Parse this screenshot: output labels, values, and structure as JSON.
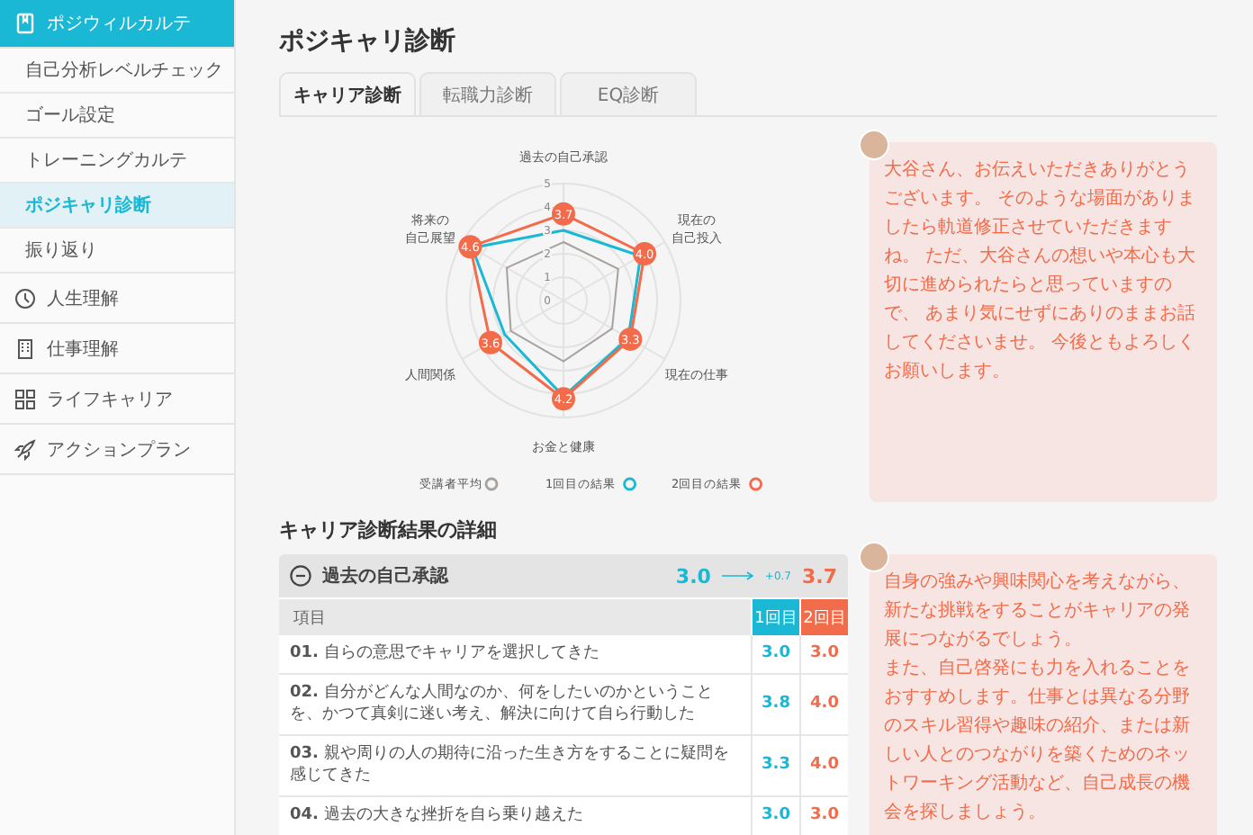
{
  "sidebar": {
    "sections": [
      {
        "label": "ポジウィルカルテ",
        "selected": true,
        "children": [
          {
            "label": "自己分析レベルチェック",
            "selected": false
          },
          {
            "label": "ゴール設定",
            "selected": false
          },
          {
            "label": "トレーニングカルテ",
            "selected": false
          },
          {
            "label": "ポジキャリ診断",
            "selected": true
          },
          {
            "label": "振り返り",
            "selected": false
          }
        ]
      },
      {
        "label": "人生理解",
        "selected": false
      },
      {
        "label": "仕事理解",
        "selected": false
      },
      {
        "label": "ライフキャリア",
        "selected": false
      },
      {
        "label": "アクションプラン",
        "selected": false
      }
    ]
  },
  "page_title": "ポジキャリ診断",
  "tabs": [
    {
      "label": "キャリア診断",
      "selected": true
    },
    {
      "label": "転職力診断",
      "selected": false
    },
    {
      "label": "EQ診断",
      "selected": false
    }
  ],
  "radar": {
    "axes": [
      "過去の自己承認",
      "現在の自己投入",
      "現在の仕事",
      "お金と健康",
      "人間関係",
      "将来の自己展望"
    ],
    "ticks": [
      "5",
      "4",
      "3",
      "2",
      "1",
      "0"
    ],
    "point_labels": [
      "3.7",
      "4.0",
      "3.3",
      "4.2",
      "3.6",
      "4.6"
    ],
    "legend": [
      {
        "name": "受講者平均",
        "color": "#a8a29e"
      },
      {
        "name": "1回目の結果",
        "color": "#1ab8d4"
      },
      {
        "name": "2回目の結果",
        "color": "#f26b4a"
      }
    ]
  },
  "comments": [
    {
      "paragraphs": [
        "大谷さん、お伝えいただきありがとうございます。 そのような場面がありましたら軌道修正させていただきますね。 ただ、大谷さんの想いや本心も大切に進められたらと思っていますので、 あまり気にせずにありのままお話してくださいませ。 今後ともよろしくお願いします。"
      ]
    },
    {
      "paragraphs": [
        "自身の強みや興味関心を考えながら、新たな挑戦をすることがキャリアの発展につながるでしょう。",
        "また、自己啓発にも力を入れることをおすすめします。仕事とは異なる分野のスキル習得や趣味の紹介、または新しい人とのつながりを築くためのネットワーキング活動など、自己成長の機会を探しましょう。"
      ]
    }
  ],
  "detail": {
    "title": "キャリア診断結果の詳細",
    "group": {
      "label": "過去の自己承認",
      "expanded": true,
      "score_first": "3.0",
      "delta": "+0.7",
      "score_second": "3.7"
    },
    "columns": [
      "項目",
      "1回目",
      "2回目"
    ],
    "rows": [
      {
        "number": "01.",
        "text": "自らの意思でキャリアを選択してきた",
        "first": "3.0",
        "second": "3.0"
      },
      {
        "number": "02.",
        "text": "自分がどんな人間なのか、何をしたいのかということを、かつて真剣に迷い考え、解決に向けて自ら行動した",
        "first": "3.8",
        "second": "4.0"
      },
      {
        "number": "03.",
        "text": "親や周りの人の期待に沿った生き方をすることに疑問を感じてきた",
        "first": "3.3",
        "second": "4.0"
      },
      {
        "number": "04.",
        "text": "過去の大きな挫折を自ら乗り越えた",
        "first": "3.0",
        "second": "3.0"
      }
    ]
  }
}
